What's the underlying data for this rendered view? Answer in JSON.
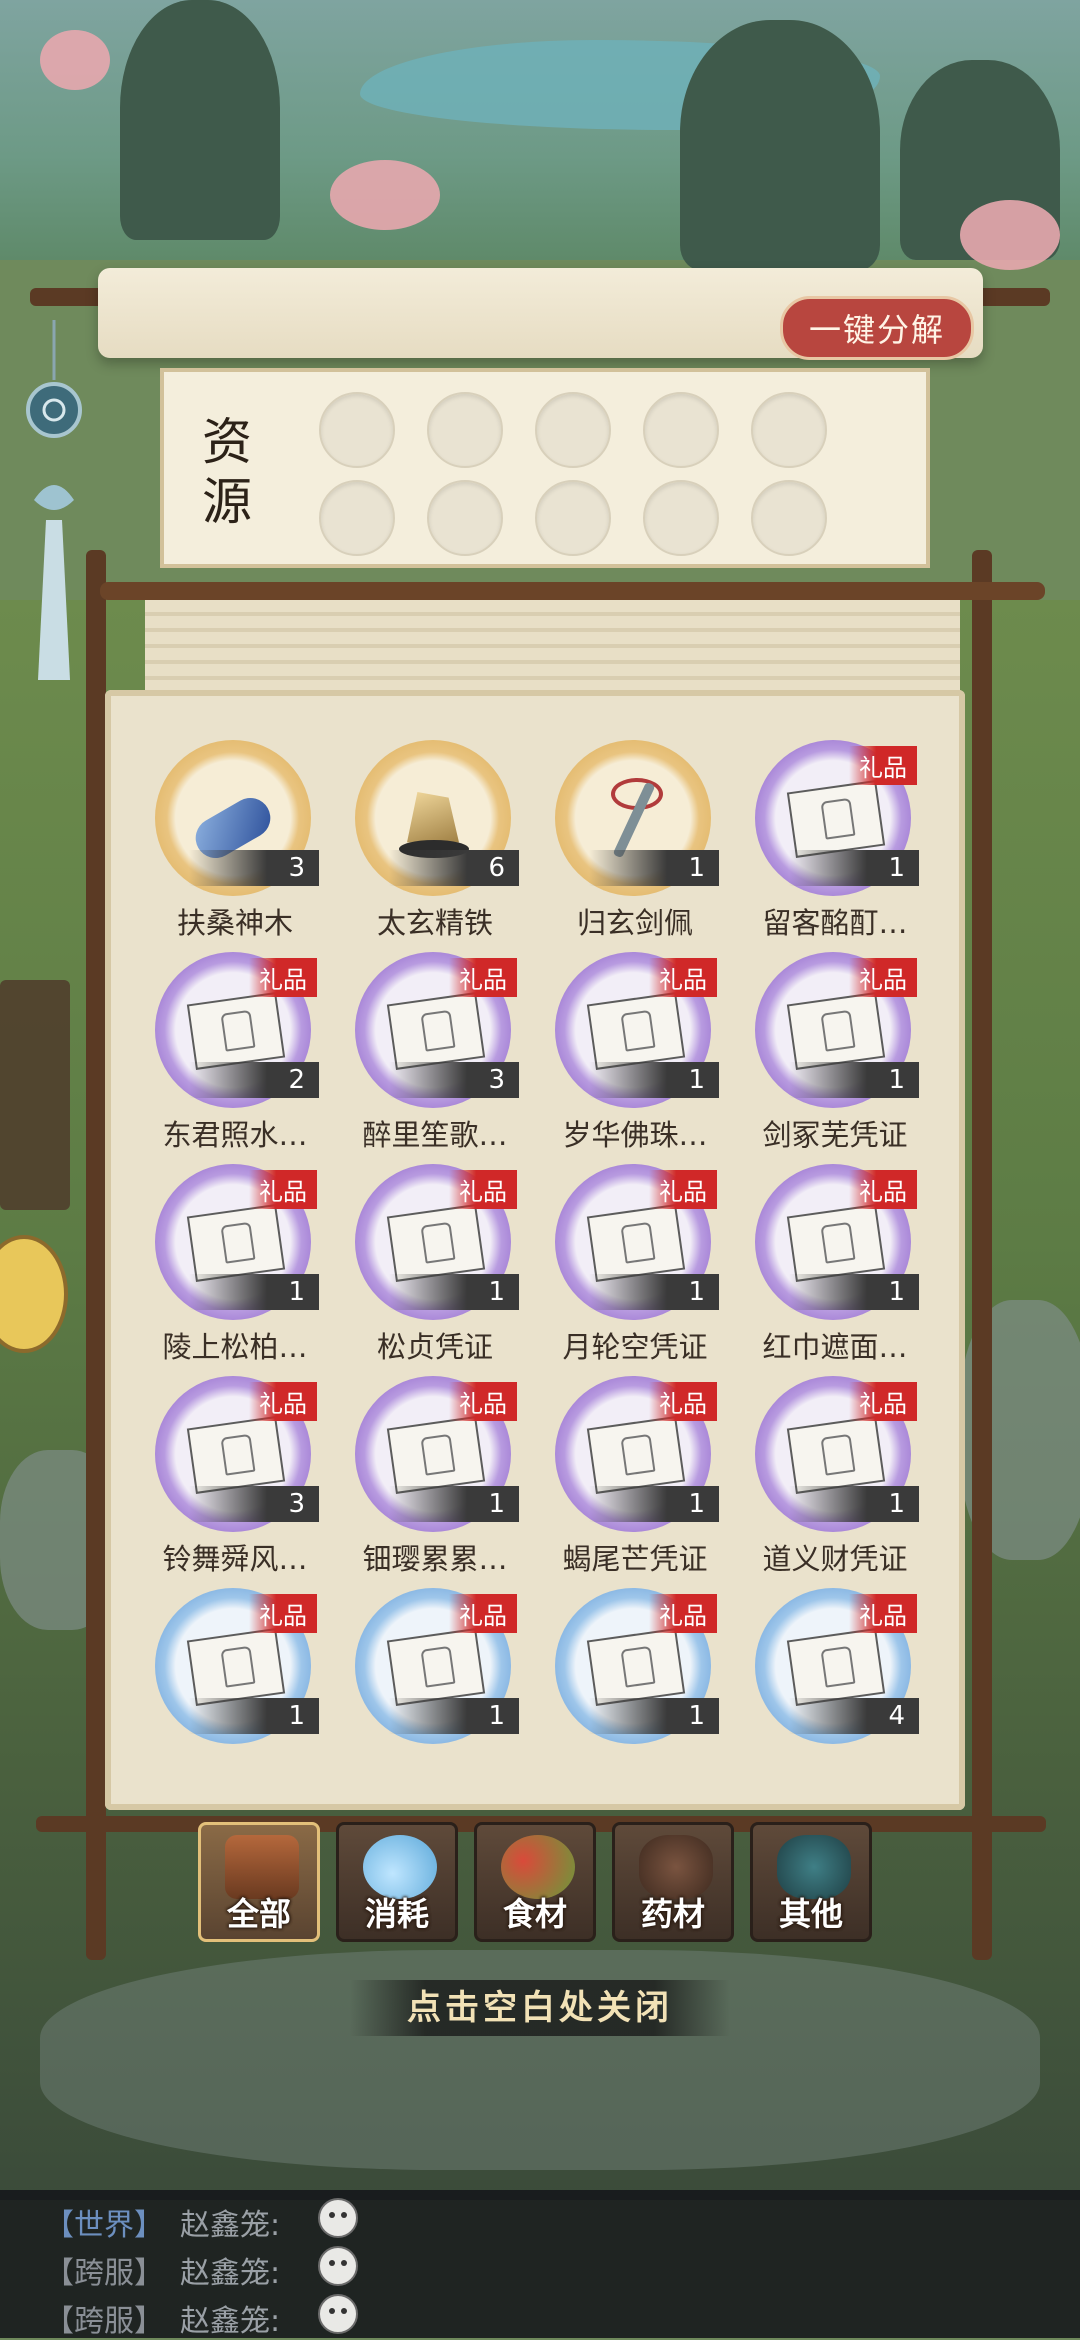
{
  "panel": {
    "decompose_button": "一键分解",
    "resource_label": "资源"
  },
  "items": [
    {
      "name": "扶桑神木",
      "count": "3",
      "frame": "gold",
      "gift": false,
      "art": "wood"
    },
    {
      "name": "太玄精铁",
      "count": "6",
      "frame": "gold",
      "gift": false,
      "art": "ore"
    },
    {
      "name": "归玄剑佩",
      "count": "1",
      "frame": "gold",
      "gift": false,
      "art": "sword"
    },
    {
      "name": "留客酩酊…",
      "count": "1",
      "frame": "purple",
      "gift": true,
      "art": "paper"
    },
    {
      "name": "东君照水…",
      "count": "2",
      "frame": "purple",
      "gift": true,
      "art": "paper"
    },
    {
      "name": "醉里笙歌…",
      "count": "3",
      "frame": "purple",
      "gift": true,
      "art": "paper"
    },
    {
      "name": "岁华佛珠…",
      "count": "1",
      "frame": "purple",
      "gift": true,
      "art": "paper"
    },
    {
      "name": "剑冢芜凭证",
      "count": "1",
      "frame": "purple",
      "gift": true,
      "art": "paper"
    },
    {
      "name": "陵上松柏…",
      "count": "1",
      "frame": "purple",
      "gift": true,
      "art": "paper"
    },
    {
      "name": "松贞凭证",
      "count": "1",
      "frame": "purple",
      "gift": true,
      "art": "paper"
    },
    {
      "name": "月轮空凭证",
      "count": "1",
      "frame": "purple",
      "gift": true,
      "art": "paper"
    },
    {
      "name": "红巾遮面…",
      "count": "1",
      "frame": "purple",
      "gift": true,
      "art": "paper"
    },
    {
      "name": "铃舞舜风…",
      "count": "3",
      "frame": "purple",
      "gift": true,
      "art": "paper"
    },
    {
      "name": "钿璎累累…",
      "count": "1",
      "frame": "purple",
      "gift": true,
      "art": "paper"
    },
    {
      "name": "蝎尾芒凭证",
      "count": "1",
      "frame": "purple",
      "gift": true,
      "art": "paper"
    },
    {
      "name": "道义财凭证",
      "count": "1",
      "frame": "purple",
      "gift": true,
      "art": "paper"
    },
    {
      "name": "",
      "count": "1",
      "frame": "blue",
      "gift": true,
      "art": "paper"
    },
    {
      "name": "",
      "count": "1",
      "frame": "blue",
      "gift": true,
      "art": "paper"
    },
    {
      "name": "",
      "count": "1",
      "frame": "blue",
      "gift": true,
      "art": "paper"
    },
    {
      "name": "",
      "count": "4",
      "frame": "blue",
      "gift": true,
      "art": "paper"
    }
  ],
  "gift_tag": "礼品",
  "tabs": [
    {
      "label": "全部",
      "icon": "chest-icon",
      "active": true
    },
    {
      "label": "消耗",
      "icon": "potion-icon",
      "active": false
    },
    {
      "label": "食材",
      "icon": "vegetables-icon",
      "active": false
    },
    {
      "label": "药材",
      "icon": "herb-pot-icon",
      "active": false
    },
    {
      "label": "其他",
      "icon": "urn-icon",
      "active": false
    }
  ],
  "close_hint": "点击空白处关闭",
  "chat": [
    {
      "channel": "【世界】",
      "name": "赵鑫笼:",
      "kind": "world"
    },
    {
      "channel": "【跨服】",
      "name": "赵鑫笼:",
      "kind": "cross"
    },
    {
      "channel": "【跨服】",
      "name": "赵鑫笼:",
      "kind": "cross"
    }
  ],
  "colors": {
    "decompose_red": "#b8463f",
    "gift_red": "#d02828",
    "frame_gold": "#d9a94f",
    "frame_purple": "#7c4bbf",
    "frame_blue": "#4f8dd0"
  }
}
